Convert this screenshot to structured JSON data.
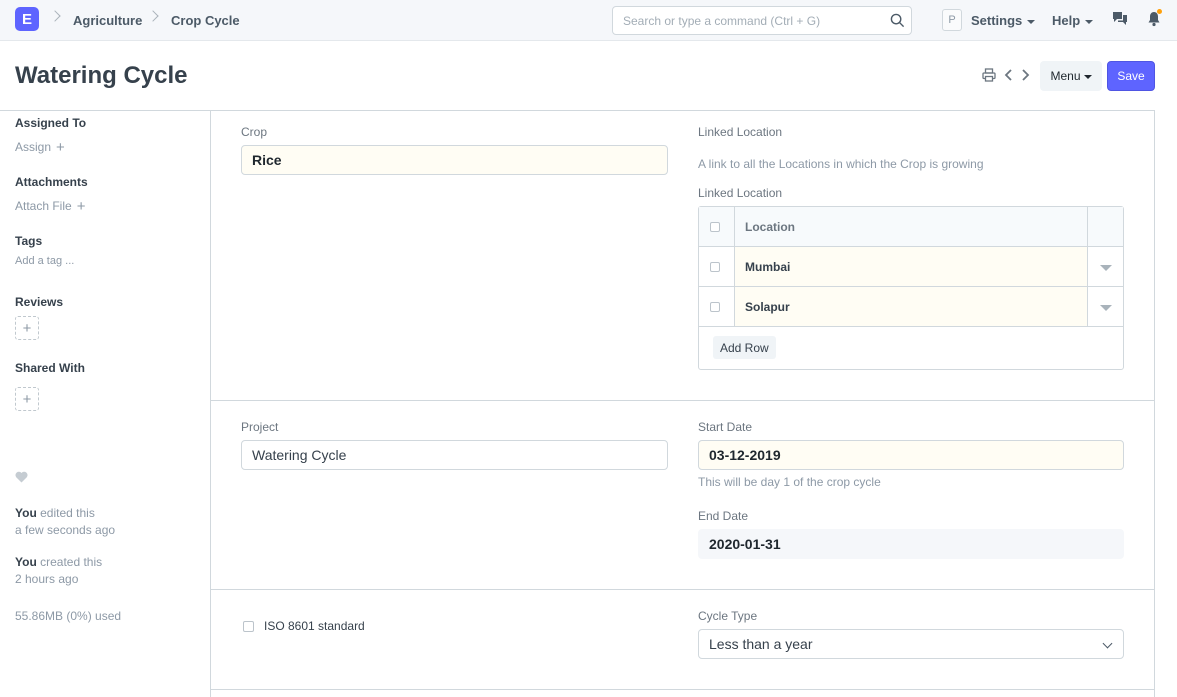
{
  "navbar": {
    "logo_letter": "E",
    "breadcrumbs": [
      "Agriculture",
      "Crop Cycle"
    ],
    "search_placeholder": "Search or type a command (Ctrl + G)",
    "avatar_letter": "P",
    "settings_label": "Settings",
    "help_label": "Help"
  },
  "page": {
    "title": "Watering Cycle",
    "menu_label": "Menu",
    "save_label": "Save"
  },
  "sidebar": {
    "assigned_to_label": "Assigned To",
    "assign_link": "Assign",
    "attachments_label": "Attachments",
    "attach_link": "Attach File",
    "tags_label": "Tags",
    "add_tag_link": "Add a tag ...",
    "reviews_label": "Reviews",
    "shared_with_label": "Shared With",
    "activity": [
      {
        "user": "You",
        "action": " edited this",
        "time": "a few seconds ago"
      },
      {
        "user": "You",
        "action": " created this",
        "time": "2 hours ago"
      }
    ],
    "storage_used": "55.86MB (0%) used"
  },
  "form": {
    "crop": {
      "label": "Crop",
      "value": "Rice"
    },
    "linked_location_section_label": "Linked Location",
    "linked_location_help": "A link to all the Locations in which the Crop is growing",
    "linked_location_table": {
      "label": "Linked Location",
      "column_header": "Location",
      "rows": [
        "Mumbai",
        "Solapur"
      ],
      "add_row_label": "Add Row"
    },
    "project": {
      "label": "Project",
      "value": "Watering Cycle"
    },
    "start_date": {
      "label": "Start Date",
      "value": "03-12-2019",
      "help": "This will be day 1 of the crop cycle"
    },
    "end_date": {
      "label": "End Date",
      "value": "2020-01-31"
    },
    "iso_label": "ISO 8601 standard",
    "cycle_type": {
      "label": "Cycle Type",
      "value": "Less than a year"
    }
  },
  "colors": {
    "primary": "#5e64ff",
    "mandatory_bg": "#fffdf4",
    "notification_dot": "#ffa00a"
  }
}
